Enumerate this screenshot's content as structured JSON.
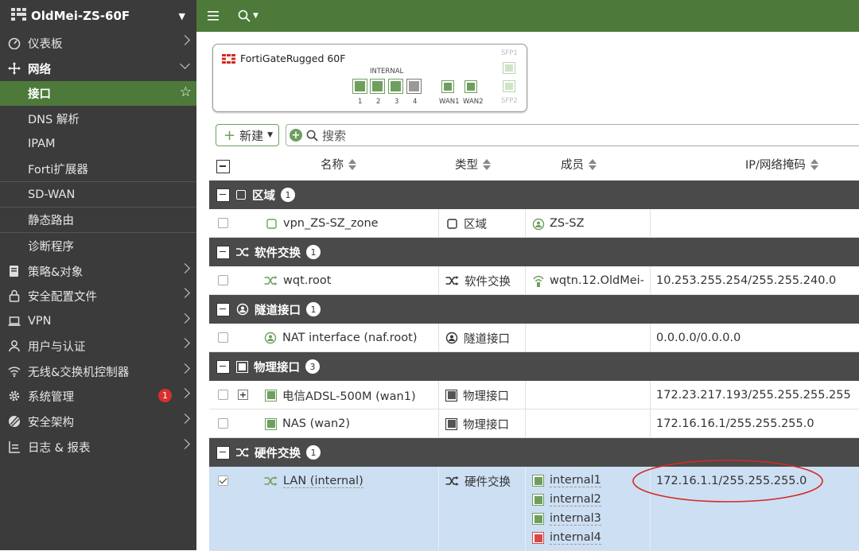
{
  "sidebar": {
    "title": "OldMei-ZS-60F",
    "items": [
      {
        "label": "仪表板",
        "icon": "dashboard-icon"
      },
      {
        "label": "网络",
        "icon": "network-icon"
      },
      {
        "label": "接口"
      },
      {
        "label": "DNS 解析"
      },
      {
        "label": "IPAM"
      },
      {
        "label": "Forti扩展器"
      },
      {
        "label": "SD-WAN"
      },
      {
        "label": "静态路由"
      },
      {
        "label": "诊断程序"
      },
      {
        "label": "策略&对象",
        "icon": "policy-icon"
      },
      {
        "label": "安全配置文件",
        "icon": "lock-icon"
      },
      {
        "label": "VPN",
        "icon": "laptop-icon"
      },
      {
        "label": "用户与认证",
        "icon": "user-icon"
      },
      {
        "label": "无线&交换机控制器",
        "icon": "wifi-icon"
      },
      {
        "label": "系统管理",
        "icon": "gear-icon",
        "badge": "1"
      },
      {
        "label": "安全架构",
        "icon": "fabric-icon"
      },
      {
        "label": "日志 & 报表",
        "icon": "log-icon"
      }
    ]
  },
  "device": {
    "name": "FortiGateRugged 60F",
    "internal_label": "INTERNAL",
    "ports": [
      "1",
      "2",
      "3",
      "4"
    ],
    "wan_ports": [
      "WAN1",
      "WAN2"
    ],
    "sfp": [
      "SFP1",
      "SFP2"
    ]
  },
  "toolbar": {
    "new_label": "新建",
    "search_placeholder": "搜索"
  },
  "table": {
    "columns": [
      "名称",
      "类型",
      "成员",
      "IP/网络掩码"
    ],
    "groups": [
      {
        "title": "区域",
        "count": "1",
        "rows": [
          {
            "name": "vpn_ZS-SZ_zone",
            "type": "区域",
            "members": [
              "ZS-SZ"
            ],
            "ip": ""
          }
        ]
      },
      {
        "title": "软件交换",
        "count": "1",
        "rows": [
          {
            "name": "wqt.root",
            "type": "软件交换",
            "members": [
              "wqtn.12.OldMei-"
            ],
            "ip": "10.253.255.254/255.255.240.0"
          }
        ]
      },
      {
        "title": "隧道接口",
        "count": "1",
        "rows": [
          {
            "name": "NAT interface (naf.root)",
            "type": "隧道接口",
            "members": [],
            "ip": "0.0.0.0/0.0.0.0"
          }
        ]
      },
      {
        "title": "物理接口",
        "count": "3",
        "rows": [
          {
            "name": "电信ADSL-500M (wan1)",
            "type": "物理接口",
            "members": [],
            "ip": "172.23.217.193/255.255.255.255"
          },
          {
            "name": "NAS (wan2)",
            "type": "物理接口",
            "members": [],
            "ip": "172.16.16.1/255.255.255.0"
          }
        ]
      },
      {
        "title": "硬件交换",
        "count": "1",
        "rows": [
          {
            "name": "LAN (internal)",
            "type": "硬件交换",
            "members": [
              "internal1",
              "internal2",
              "internal3",
              "internal4"
            ],
            "ip": "172.16.1.1/255.255.255.0"
          }
        ]
      }
    ]
  },
  "colors": {
    "brand_green": "#4d7a3a",
    "sidebar_bg": "#3b3b3b",
    "selected_row": "#cddff3",
    "annotation_red": "#d42a20"
  }
}
